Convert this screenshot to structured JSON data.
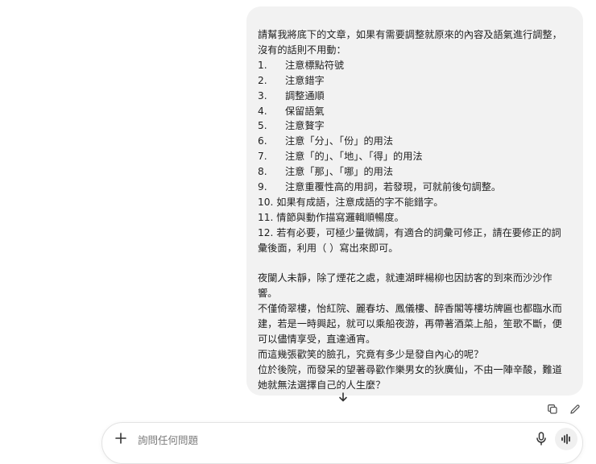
{
  "message": {
    "intro_1": "請幫我將底下的文章，如果有需要調整就原來的內容及語氣進行調整，",
    "intro_2": "沒有的話則不用動：",
    "rules": [
      {
        "num": "1.",
        "text": "注意標點符號"
      },
      {
        "num": "2.",
        "text": "注意錯字"
      },
      {
        "num": "3.",
        "text": "調整通順"
      },
      {
        "num": "4.",
        "text": "保留語氣"
      },
      {
        "num": "5.",
        "text": "注意贅字"
      },
      {
        "num": "6.",
        "text": "注意「分」、「份」的用法"
      },
      {
        "num": "7.",
        "text": "注意「的」、「地」、「得」的用法"
      },
      {
        "num": "8.",
        "text": "注意「那」、「哪」的用法"
      },
      {
        "num": "9.",
        "text": "注意重覆性高的用詞，若發現，可就前後句調整。"
      }
    ],
    "rule_10": "10. 如果有成語，注意成語的字不能錯字。",
    "rule_11": "11. 情節與動作描寫邏輯順暢度。",
    "rule_12a": "12. 若有必要，可極少量微調，有適合的詞彙可修正，請在要修正的詞",
    "rule_12b": "彙後面，利用（ ）寫出來即可。",
    "story": [
      "夜闌人未靜，除了煙花之處，就連湖畔楊柳也因訪客的到來而沙沙作",
      "響。",
      "不僅倚翠樓，怡紅院、麗春坊、鳳儀樓、醉香閣等樓坊牌匾也都臨水而",
      "建，若是一時興起，就可以乘船夜游，再帶著酒菜上船，笙歌不斷，便",
      "可以儘情享受，直達通宵。",
      "而這幾張歡笑的臉孔，究竟有多少是發自內心的呢？",
      "位於後院，而發呆的望著尋歡作樂男女的狄廣仙，不由一陣辛酸，難道",
      "她就無法選擇自己的人生麼？"
    ]
  },
  "composer": {
    "placeholder": "詢問任何問題"
  },
  "icons": {
    "scroll": "arrow-down-icon",
    "copy": "copy-icon",
    "edit": "pencil-icon",
    "plus": "plus-icon",
    "mic": "microphone-icon",
    "voice": "voice-wave-icon"
  },
  "colors": {
    "bubble": "#f2f2f2",
    "text": "#1f1f1f",
    "placeholder": "#7a7a7a"
  }
}
